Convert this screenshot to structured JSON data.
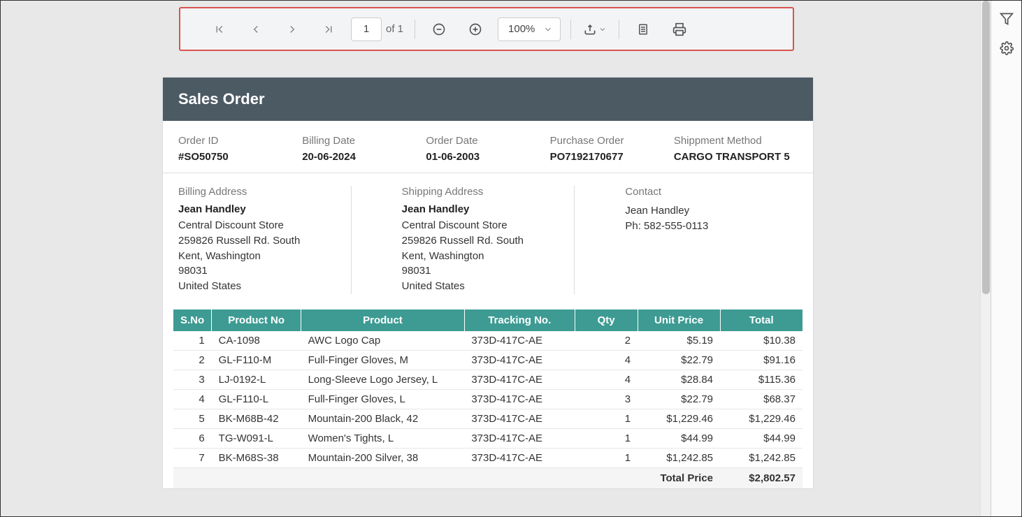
{
  "toolbar": {
    "page_current": "1",
    "page_of": "of 1",
    "zoom": "100%"
  },
  "report": {
    "title": "Sales Order",
    "meta": {
      "order_id_label": "Order ID",
      "order_id_value": "#SO50750",
      "billing_date_label": "Billing Date",
      "billing_date_value": "20-06-2024",
      "order_date_label": "Order Date",
      "order_date_value": "01-06-2003",
      "po_label": "Purchase Order",
      "po_value": "PO7192170677",
      "ship_label": "Shippment Method",
      "ship_value": "CARGO TRANSPORT 5"
    },
    "billing": {
      "title": "Billing Address",
      "name": "Jean Handley",
      "line1": "Central Discount Store",
      "line2": "259826 Russell Rd. South",
      "line3": "Kent, Washington",
      "line4": "98031",
      "line5": "United States"
    },
    "shipping": {
      "title": "Shipping Address",
      "name": "Jean Handley",
      "line1": "Central Discount Store",
      "line2": "259826 Russell Rd. South",
      "line3": "Kent, Washington",
      "line4": "98031",
      "line5": "United States"
    },
    "contact": {
      "title": "Contact",
      "name": "Jean Handley",
      "phone": "Ph: 582-555-0113"
    },
    "cols": {
      "sno": "S.No",
      "pno": "Product No",
      "prod": "Product",
      "track": "Tracking No.",
      "qty": "Qty",
      "price": "Unit Price",
      "total": "Total"
    },
    "rows": [
      {
        "sno": "1",
        "pno": "CA-1098",
        "prod": "AWC Logo Cap",
        "track": "373D-417C-AE",
        "qty": "2",
        "price": "$5.19",
        "total": "$10.38"
      },
      {
        "sno": "2",
        "pno": "GL-F110-M",
        "prod": "Full-Finger Gloves, M",
        "track": "373D-417C-AE",
        "qty": "4",
        "price": "$22.79",
        "total": "$91.16"
      },
      {
        "sno": "3",
        "pno": "LJ-0192-L",
        "prod": "Long-Sleeve Logo Jersey, L",
        "track": "373D-417C-AE",
        "qty": "4",
        "price": "$28.84",
        "total": "$115.36"
      },
      {
        "sno": "4",
        "pno": "GL-F110-L",
        "prod": "Full-Finger Gloves, L",
        "track": "373D-417C-AE",
        "qty": "3",
        "price": "$22.79",
        "total": "$68.37"
      },
      {
        "sno": "5",
        "pno": "BK-M68B-42",
        "prod": "Mountain-200 Black, 42",
        "track": "373D-417C-AE",
        "qty": "1",
        "price": "$1,229.46",
        "total": "$1,229.46"
      },
      {
        "sno": "6",
        "pno": "TG-W091-L",
        "prod": "Women's Tights, L",
        "track": "373D-417C-AE",
        "qty": "1",
        "price": "$44.99",
        "total": "$44.99"
      },
      {
        "sno": "7",
        "pno": "BK-M68S-38",
        "prod": "Mountain-200 Silver, 38",
        "track": "373D-417C-AE",
        "qty": "1",
        "price": "$1,242.85",
        "total": "$1,242.85"
      }
    ],
    "total_label": "Total Price",
    "total_value": "$2,802.57"
  }
}
